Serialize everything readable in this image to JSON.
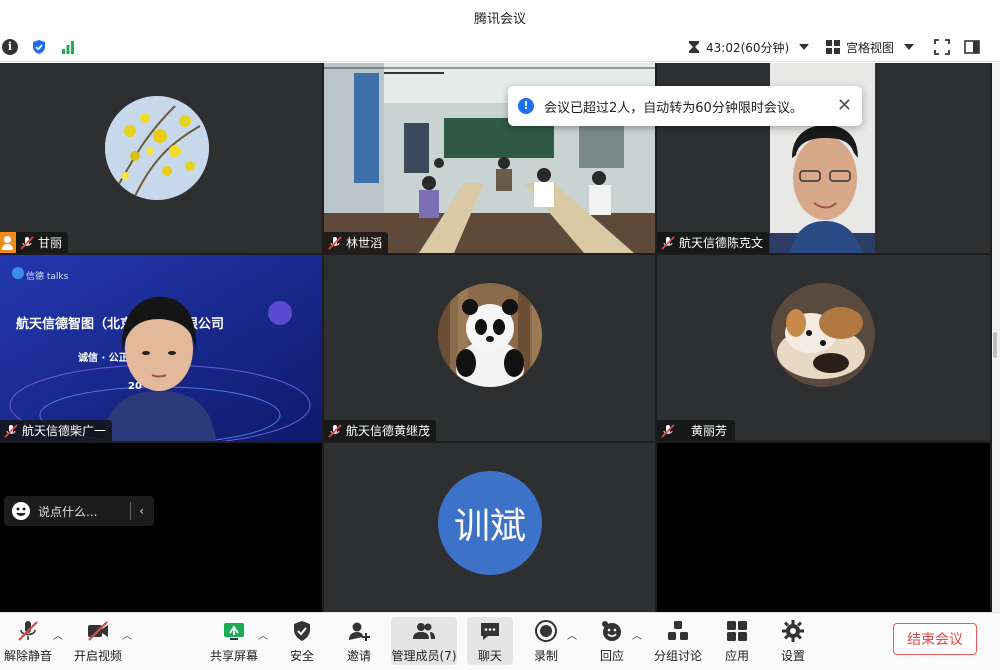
{
  "window": {
    "title": "腾讯会议"
  },
  "statusbar": {
    "timer": "43:02(60分钟)",
    "view_mode": "宫格视图"
  },
  "toast": {
    "message": "会议已超过2人，自动转为60分钟限时会议。"
  },
  "participants": [
    {
      "name": "甘丽"
    },
    {
      "name": "林世滔"
    },
    {
      "name": "航天信德陈克文"
    },
    {
      "name": "航天信德柴广一"
    },
    {
      "name": "航天信德黄继茂"
    },
    {
      "name": "黄丽芳"
    },
    {
      "name": "训斌",
      "avatar_text": "训斌"
    }
  ],
  "slide": {
    "brand": "信德 talks",
    "company": "航天信德智图（北京）科技有限公司",
    "motto": "诚信 · 公正",
    "year": "20"
  },
  "chat": {
    "placeholder": "说点什么..."
  },
  "toolbar": {
    "unmute": "解除静音",
    "start_video": "开启视频",
    "share_screen": "共享屏幕",
    "security": "安全",
    "invite": "邀请",
    "manage_members": "管理成员(7)",
    "chat": "聊天",
    "record": "录制",
    "reactions": "回应",
    "breakout": "分组讨论",
    "apps": "应用",
    "settings": "设置",
    "end_meeting": "结束会议"
  },
  "colors": {
    "accent": "#1e6ff0",
    "end_red": "#e04848",
    "share_green": "#1aad53",
    "tile_bg": "#2d2f31",
    "avatar_blue": "#3d72c9"
  }
}
